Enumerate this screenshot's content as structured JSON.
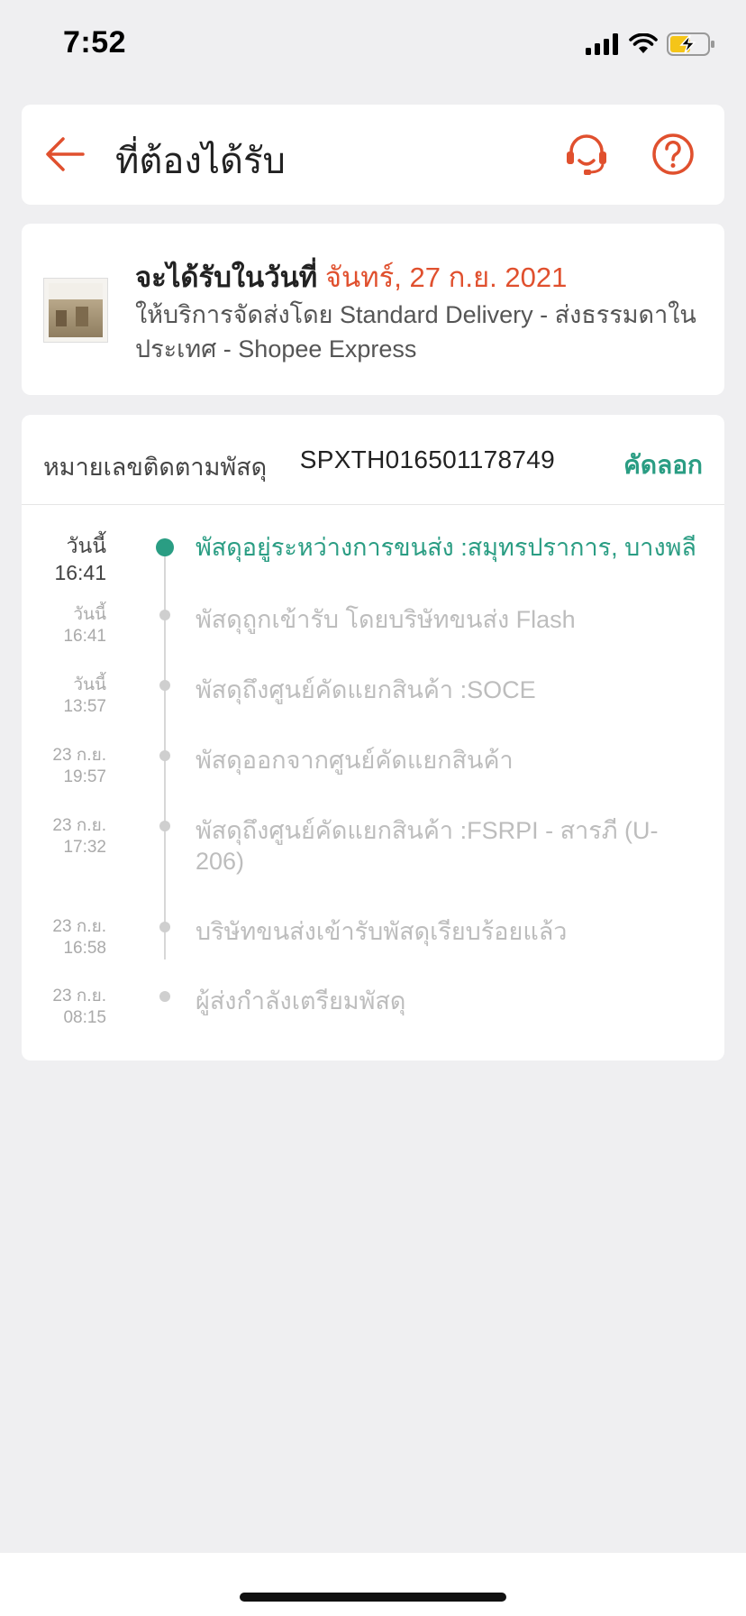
{
  "status_bar": {
    "time": "7:52"
  },
  "header": {
    "title": "ที่ต้องได้รับ"
  },
  "delivery": {
    "eta_prefix": "จะได้รับในวันที่",
    "eta_date": "จันทร์, 27 ก.ย. 2021",
    "service": "ให้บริการจัดส่งโดย Standard Delivery - ส่งธรรมดาในประเทศ - Shopee Express"
  },
  "tracking": {
    "label": "หมายเลขติดตามพัสดุ",
    "number": "SPXTH016501178749",
    "copy_label": "คัดลอก",
    "events": [
      {
        "day": "วันนี้",
        "time": "16:41",
        "text": "พัสดุอยู่ระหว่างการขนส่ง :สมุทรปราการ, บางพลี"
      },
      {
        "day": "วันนี้",
        "time": "16:41",
        "text": "พัสดุถูกเข้ารับ โดยบริษัทขนส่ง Flash"
      },
      {
        "day": "วันนี้",
        "time": "13:57",
        "text": "พัสดุถึงศูนย์คัดแยกสินค้า :SOCE"
      },
      {
        "day": "23 ก.ย.",
        "time": "19:57",
        "text": "พัสดุออกจากศูนย์คัดแยกสินค้า"
      },
      {
        "day": "23 ก.ย.",
        "time": "17:32",
        "text": "พัสดุถึงศูนย์คัดแยกสินค้า :FSRPI - สารภี (U-206)"
      },
      {
        "day": "23 ก.ย.",
        "time": "16:58",
        "text": "บริษัทขนส่งเข้ารับพัสดุเรียบร้อยแล้ว"
      },
      {
        "day": "23 ก.ย.",
        "time": "08:15",
        "text": "ผู้ส่งกำลังเตรียมพัสดุ"
      }
    ]
  },
  "colors": {
    "accent": "#e0502e",
    "green": "#2a9d83"
  },
  "icons": {
    "back": "arrow-left-icon",
    "support": "headset-icon",
    "help": "question-circle-icon"
  }
}
